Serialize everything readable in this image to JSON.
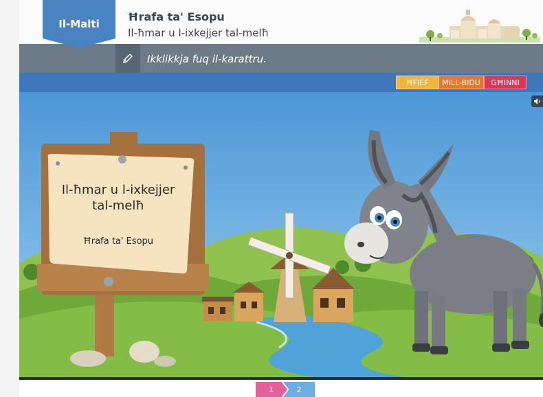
{
  "header": {
    "language": "Il-Malti",
    "series_title": "Ħrafa ta' Esopu",
    "story_title": "Il-ħmar u l-ixkejjer tal-melħ"
  },
  "instruction": {
    "icon": "pencil-icon",
    "text": "Ikklikkja fuq il-karattru."
  },
  "levels": [
    {
      "label": "ĦFIEF",
      "color": "#f4b43a"
    },
    {
      "label": "MILL-BIDU",
      "color": "#e8772e"
    },
    {
      "label": "GĦINNI",
      "color": "#d9385b"
    }
  ],
  "sound_button": {
    "icon": "speaker-icon"
  },
  "sign": {
    "title": "Il-ħmar u l-ixkejjer tal-melħ",
    "subtitle": "Ħrafa ta' Esopu"
  },
  "pagination": {
    "pages": [
      "1",
      "2"
    ],
    "current": "1"
  },
  "colors": {
    "brand_blue": "#4a83c2",
    "instruction_bar": "#6c7b87",
    "strip_blue": "#3d78bd",
    "sky": "#5ea6dd"
  }
}
